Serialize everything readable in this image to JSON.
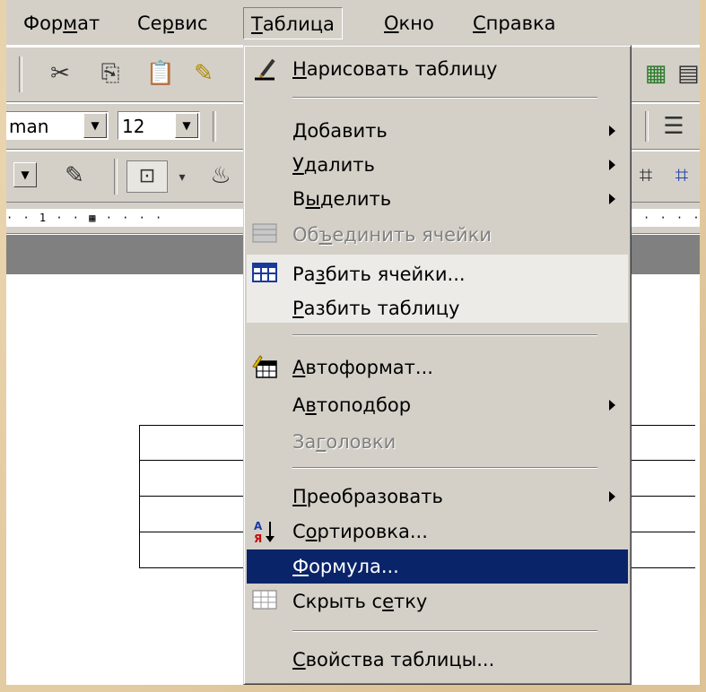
{
  "menubar": [
    {
      "pre": "Фор",
      "key": "м",
      "post": "ат"
    },
    {
      "pre": "Се",
      "key": "р",
      "post": "вис"
    },
    {
      "pre": "",
      "key": "Т",
      "post": "аблица"
    },
    {
      "pre": "",
      "key": "О",
      "post": "кно"
    },
    {
      "pre": "",
      "key": "С",
      "post": "правка"
    }
  ],
  "toolbar": {
    "font_name": "man",
    "font_size": "12"
  },
  "ruler_text": "· · 1 · ·  ▦   · · · ·",
  "ruler_text_right": "· · · ·",
  "table_menu": {
    "items": [
      {
        "pre": "",
        "key": "Н",
        "post": "арисовать таблицу",
        "icon": "pencil-icon",
        "submenu": false,
        "state": "normal"
      },
      {
        "pre": "",
        "key": "Д",
        "post": "обавить",
        "icon": "",
        "submenu": true,
        "state": "normal"
      },
      {
        "pre": "",
        "key": "У",
        "post": "далить",
        "icon": "",
        "submenu": true,
        "state": "normal"
      },
      {
        "pre": "В",
        "key": "ы",
        "post": "делить",
        "icon": "",
        "submenu": true,
        "state": "normal"
      },
      {
        "pre": "Об",
        "key": "ъ",
        "post": "единить ячейки",
        "icon": "merge-cells-icon",
        "submenu": false,
        "state": "disabled"
      },
      {
        "pre": "Ра",
        "key": "з",
        "post": "бить ячейки...",
        "icon": "split-cells-icon",
        "submenu": false,
        "state": "recessed"
      },
      {
        "pre": "",
        "key": "Р",
        "post": "азбить таблицу",
        "icon": "",
        "submenu": false,
        "state": "normal"
      },
      {
        "pre": "",
        "key": "А",
        "post": "втоформат...",
        "icon": "autoformat-icon",
        "submenu": false,
        "state": "normal"
      },
      {
        "pre": "А",
        "key": "в",
        "post": "топодбор",
        "icon": "",
        "submenu": true,
        "state": "normal"
      },
      {
        "pre": "За",
        "key": "г",
        "post": "оловки",
        "icon": "",
        "submenu": false,
        "state": "disabled"
      },
      {
        "pre": "",
        "key": "П",
        "post": "реобразовать",
        "icon": "",
        "submenu": true,
        "state": "normal"
      },
      {
        "pre": "С",
        "key": "о",
        "post": "ртировка...",
        "icon": "sort-icon",
        "submenu": false,
        "state": "normal"
      },
      {
        "pre": "",
        "key": "Ф",
        "post": "ормула...",
        "icon": "",
        "submenu": false,
        "state": "highlight"
      },
      {
        "pre": "Скрыть с",
        "key": "е",
        "post": "тку",
        "icon": "grid-icon",
        "submenu": false,
        "state": "normal"
      },
      {
        "pre": "",
        "key": "С",
        "post": "войства таблицы...",
        "icon": "",
        "submenu": false,
        "state": "normal"
      }
    ]
  },
  "colors": {
    "highlight": "#0a246a",
    "menu_bg": "#d4d0c8"
  }
}
